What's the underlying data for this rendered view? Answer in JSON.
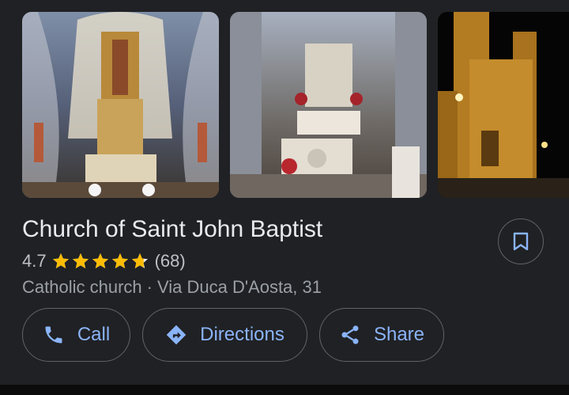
{
  "place": {
    "name": "Church of Saint John Baptist",
    "rating": "4.7",
    "stars": 4.7,
    "review_count": "(68)",
    "category": "Catholic church",
    "separator": "·",
    "address": "Via Duca D'Aosta, 31"
  },
  "actions": {
    "call_label": "Call",
    "directions_label": "Directions",
    "share_label": "Share"
  },
  "photos": [
    {
      "icon": "altar-interior-photo"
    },
    {
      "icon": "church-altar-photo"
    },
    {
      "icon": "church-exterior-night-photo"
    }
  ],
  "icons": {
    "save": "bookmark-icon",
    "call": "phone-icon",
    "directions": "directions-icon",
    "share": "share-icon",
    "star": "star-icon"
  },
  "colors": {
    "background": "#202124",
    "accent": "#8ab4f8",
    "star": "#fbbc04",
    "border": "#5f6368"
  }
}
